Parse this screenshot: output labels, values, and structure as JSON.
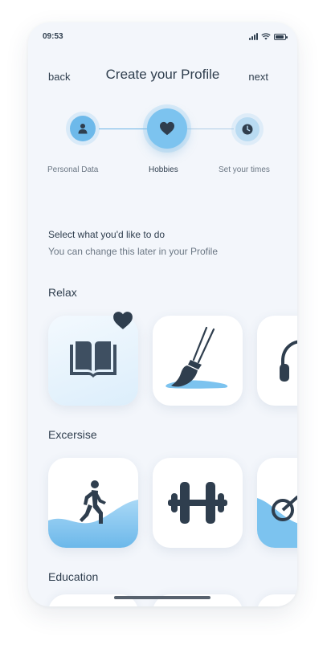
{
  "status_bar": {
    "time": "09:53"
  },
  "nav": {
    "back_label": "back",
    "title": "Create your Profile",
    "next_label": "next"
  },
  "stepper": {
    "steps": [
      {
        "label": "Personal Data",
        "icon": "person-icon",
        "state": "done"
      },
      {
        "label": "Hobbies",
        "icon": "heart-icon",
        "state": "active"
      },
      {
        "label": "Set your times",
        "icon": "clock-icon",
        "state": "upcoming"
      }
    ]
  },
  "intro": {
    "heading": "Select what you'd like to do",
    "subheading": "You can change this later in your Profile"
  },
  "categories": [
    {
      "title": "Relax",
      "tiles": [
        {
          "icon": "book-icon",
          "selected": true
        },
        {
          "icon": "paintbrush-icon",
          "selected": false
        },
        {
          "icon": "headphones-icon",
          "selected": false
        }
      ]
    },
    {
      "title": "Excersise",
      "tiles": [
        {
          "icon": "walking-icon",
          "selected": false
        },
        {
          "icon": "dumbbell-icon",
          "selected": false
        },
        {
          "icon": "bicycle-icon",
          "selected": false
        }
      ]
    },
    {
      "title": "Education",
      "tiles": []
    }
  ],
  "colors": {
    "accent": "#7cc3ef",
    "accent_dark": "#5aa8dc",
    "icon": "#2f3e4e",
    "background": "#f3f6fb",
    "tile": "#ffffff"
  }
}
